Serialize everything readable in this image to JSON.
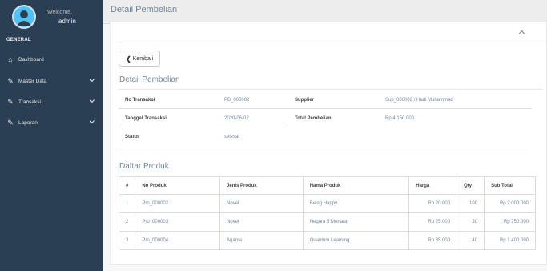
{
  "sidebar": {
    "welcome": "Welcome,",
    "username": "admin",
    "section": "GENERAL",
    "items": [
      {
        "label": "Dashboard",
        "icon": "home-icon"
      },
      {
        "label": "Master Data",
        "icon": "edit-icon"
      },
      {
        "label": "Transaksi",
        "icon": "edit-icon"
      },
      {
        "label": "Laporan",
        "icon": "edit-icon"
      }
    ]
  },
  "header": {
    "title": "Detail Pembelian"
  },
  "panel": {
    "back_label": "Kembali",
    "heading": "Detail Pembelian",
    "info": {
      "no_transaksi_label": "No Transaksi",
      "no_transaksi": "PB_000002",
      "tanggal_label": "Tanggal Transaksi",
      "tanggal": "2020-06-02",
      "status_label": "Status",
      "status": "selesai",
      "supplier_label": "Supplier",
      "supplier": "Sup_000002 / Hadi Muhammad",
      "total_label": "Total Pembelian",
      "total": "Rp 4.150.000"
    },
    "products_heading": "Daftar Produk",
    "table": {
      "headers": [
        "#",
        "No Produk",
        "Jenis Produk",
        "Nama Produk",
        "Harga",
        "Qty",
        "Sub Total"
      ],
      "rows": [
        [
          "1",
          "Pro_000002",
          "Novel",
          "Being Happy",
          "Rp 20.000",
          "100",
          "Rp 2.000.000"
        ],
        [
          "2",
          "Pro_000003",
          "Novel",
          "Negara 5 Menara",
          "Rp 25.000",
          "30",
          "Rp 750.000"
        ],
        [
          "3",
          "Pro_000004",
          "Agama",
          "Quantum Learning",
          "Rp 35.000",
          "40",
          "Rp 1.400.000"
        ]
      ]
    }
  },
  "colors": {
    "sidebar_bg": "#2a3f54",
    "text_muted": "#73879c",
    "border": "#dddddd"
  }
}
